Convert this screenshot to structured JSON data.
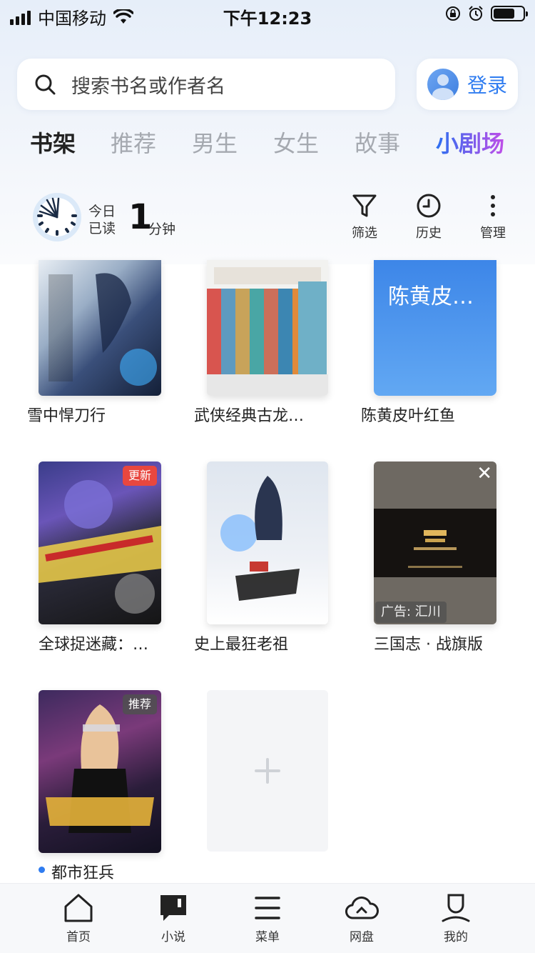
{
  "status_bar": {
    "carrier": "中国移动",
    "time": "下午12:23"
  },
  "search": {
    "placeholder": "搜索书名或作者名"
  },
  "login": {
    "label": "登录"
  },
  "tabs": [
    {
      "label": "书架",
      "active": true
    },
    {
      "label": "推荐"
    },
    {
      "label": "男生"
    },
    {
      "label": "女生"
    },
    {
      "label": "故事"
    },
    {
      "label": "小剧场"
    }
  ],
  "reading": {
    "today_read_line1": "今日",
    "today_read_line2": "已读",
    "minutes": "1",
    "unit": "分钟"
  },
  "tools": {
    "filter": "筛选",
    "history": "历史",
    "manage": "管理"
  },
  "books": [
    {
      "title": "雪中悍刀行"
    },
    {
      "title": "武侠经典古龙…"
    },
    {
      "title": "陈黄皮叶红鱼",
      "cover_text": "陈黄皮…"
    },
    {
      "title": "全球捉迷藏：…",
      "badge": "更新"
    },
    {
      "title": "史上最狂老祖"
    },
    {
      "title": "三国志 · 战旗版",
      "ad_label": "广告: 汇川"
    },
    {
      "title": "都市狂兵",
      "badge": "推荐"
    }
  ],
  "bottom_nav": [
    {
      "label": "首页",
      "icon": "home-icon"
    },
    {
      "label": "小说",
      "icon": "book-chat-icon"
    },
    {
      "label": "菜单",
      "icon": "menu-icon"
    },
    {
      "label": "网盘",
      "icon": "cloud-icon"
    },
    {
      "label": "我的",
      "icon": "user-icon"
    }
  ],
  "colors": {
    "accent": "#2f7cf0",
    "badge_update": "#e8473f",
    "badge_recommend": "#6b6b6b"
  }
}
